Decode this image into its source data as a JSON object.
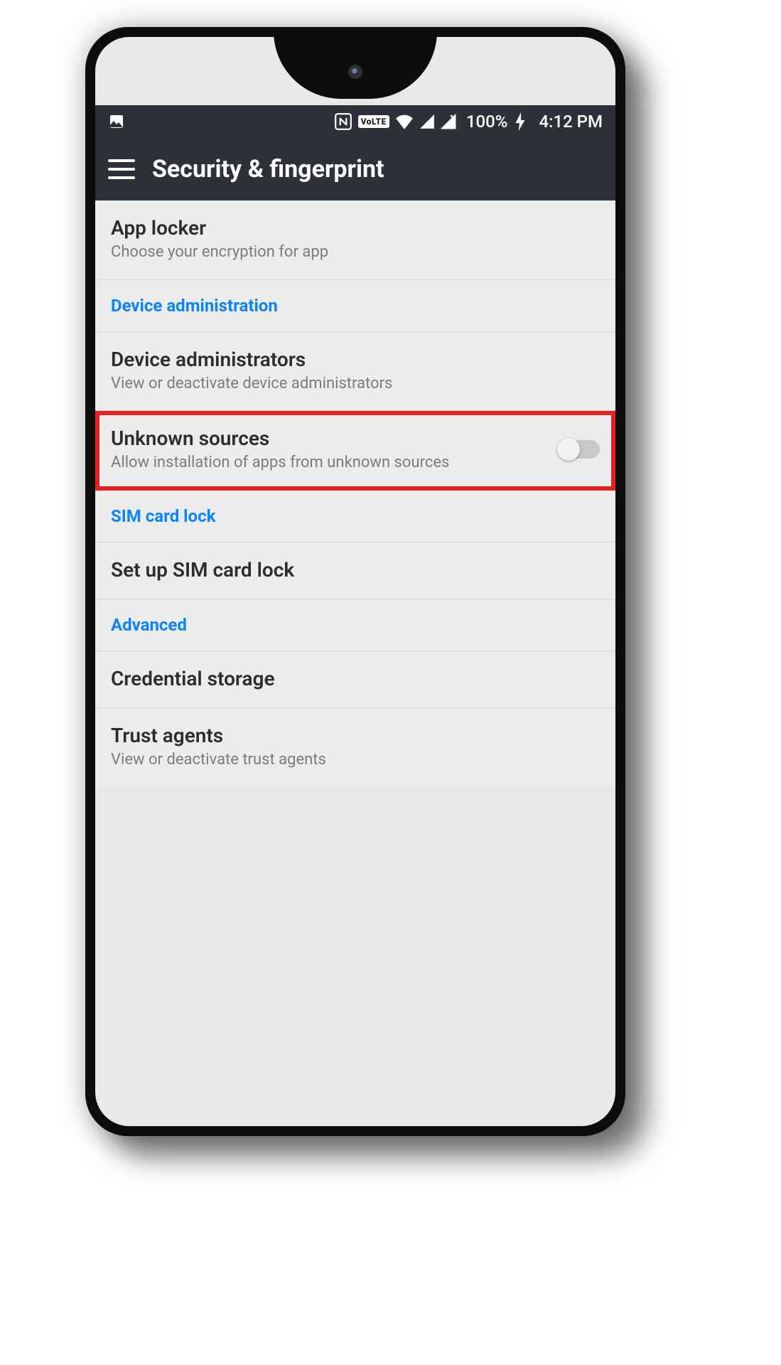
{
  "status": {
    "battery_text": "100%",
    "time": "4:12 PM"
  },
  "appbar": {
    "title": "Security & fingerprint"
  },
  "rows": {
    "app_locker": {
      "title": "App locker",
      "sub": "Choose your encryption for app"
    },
    "device_admin_header": "Device administration",
    "device_admins": {
      "title": "Device administrators",
      "sub": "View or deactivate device administrators"
    },
    "unknown_sources": {
      "title": "Unknown sources",
      "sub": "Allow installation of apps from unknown sources",
      "toggle_on": false
    },
    "sim_header": "SIM card lock",
    "sim_setup": {
      "title": "Set up SIM card lock"
    },
    "advanced_header": "Advanced",
    "credential": {
      "title": "Credential storage"
    },
    "trust_agents": {
      "title": "Trust agents",
      "sub": "View or deactivate trust agents"
    }
  }
}
